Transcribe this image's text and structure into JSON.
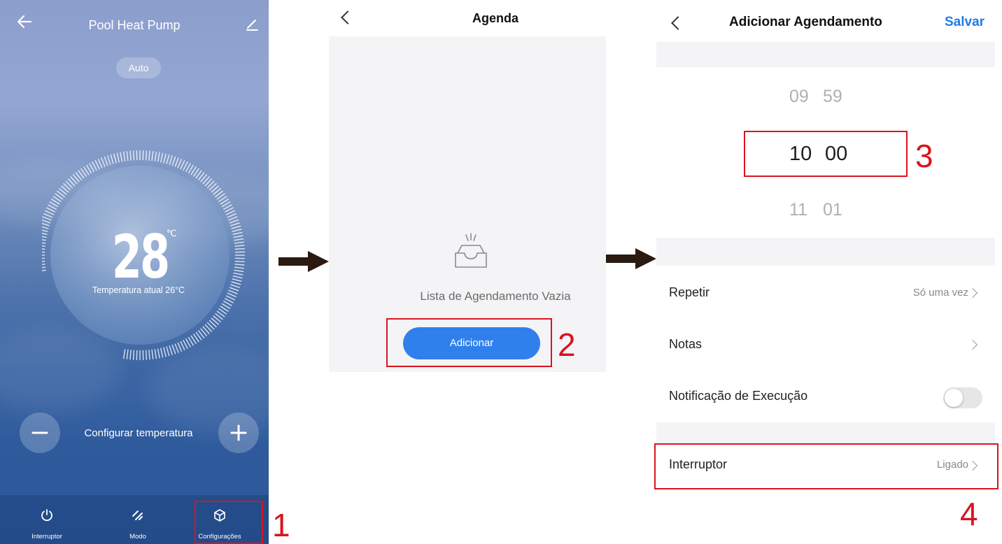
{
  "screen1": {
    "title": "Pool Heat Pump",
    "mode_badge": "Auto",
    "set_temperature": "28",
    "unit": "℃",
    "current_temperature": "Temperatura atual 26°C",
    "set_temp_label": "Configurar temperatura",
    "tabs": [
      {
        "label": "Interruptor",
        "icon": "power-icon"
      },
      {
        "label": "Modo",
        "icon": "mode-icon"
      },
      {
        "label": "Configurações",
        "icon": "cube-icon"
      }
    ]
  },
  "screen2": {
    "title": "Agenda",
    "empty_text": "Lista de Agendamento Vazia",
    "add_button": "Adicionar"
  },
  "screen3": {
    "title": "Adicionar Agendamento",
    "save": "Salvar",
    "time_picker": {
      "prev": {
        "hour": "09",
        "minute": "59"
      },
      "selected": {
        "hour": "10",
        "minute": "00"
      },
      "next": {
        "hour": "11",
        "minute": "01"
      }
    },
    "rows": {
      "repeat": {
        "label": "Repetir",
        "value": "Só uma vez"
      },
      "notes": {
        "label": "Notas",
        "value": ""
      },
      "notify": {
        "label": "Notificação de Execução",
        "enabled": false
      },
      "switch": {
        "label": "Interruptor",
        "value": "Ligado"
      }
    }
  },
  "callouts": [
    "1",
    "2",
    "3",
    "4"
  ],
  "colors": {
    "accent_blue": "#2f80ed",
    "save_blue": "#1f7aea",
    "callout_red": "#d8151f"
  }
}
